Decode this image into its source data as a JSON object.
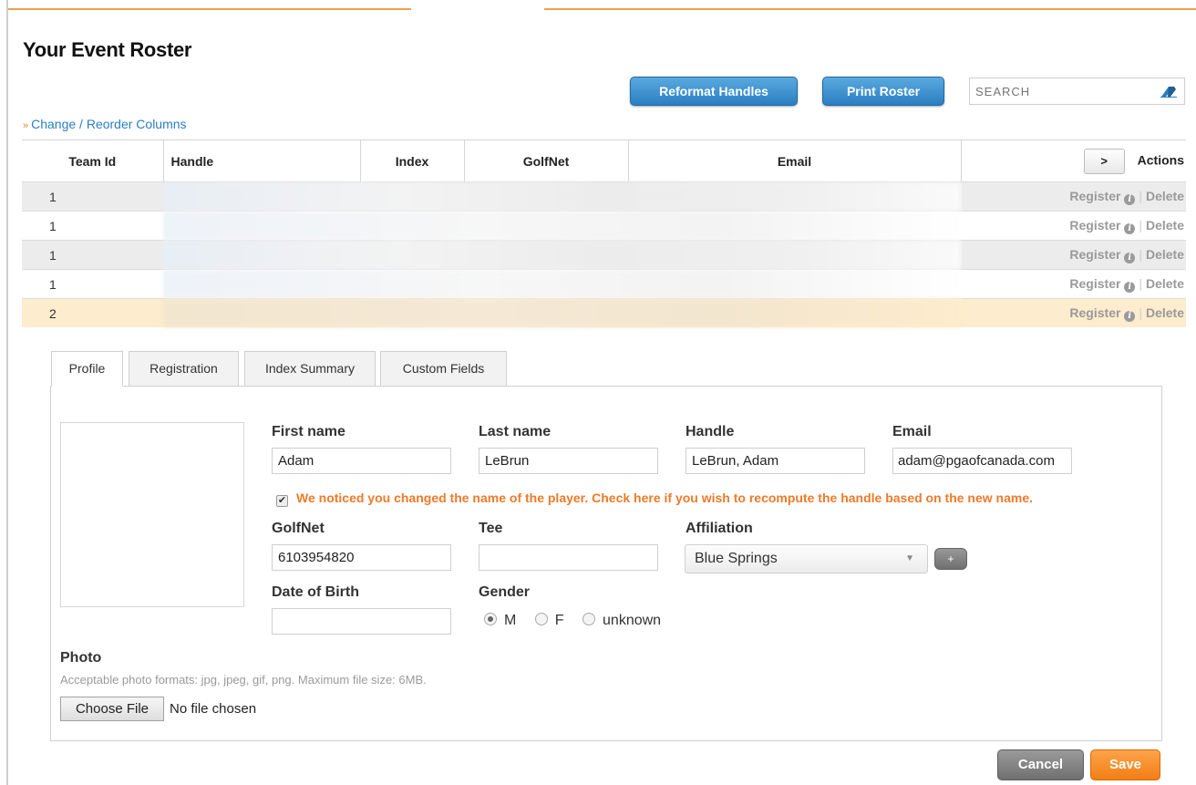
{
  "page": {
    "title": "Your Event Roster"
  },
  "toolbar": {
    "reformat_label": "Reformat Handles",
    "print_label": "Print Roster",
    "search_placeholder": "SEARCH",
    "reorder_label": "Change / Reorder Columns"
  },
  "table": {
    "headers": [
      "Team Id",
      "Handle",
      "Index",
      "GolfNet",
      "Email",
      "Actions"
    ],
    "next_label": ">",
    "register_label": "Register",
    "delete_label": "Delete",
    "rows": [
      {
        "team_id": "1"
      },
      {
        "team_id": "1"
      },
      {
        "team_id": "1"
      },
      {
        "team_id": "1"
      },
      {
        "team_id": "2",
        "selected": true
      }
    ]
  },
  "tabs": [
    "Profile",
    "Registration",
    "Index Summary",
    "Custom Fields"
  ],
  "profile": {
    "first_name_label": "First name",
    "first_name": "Adam",
    "last_name_label": "Last name",
    "last_name": "LeBrun",
    "handle_label": "Handle",
    "handle": "LeBrun, Adam",
    "email_label": "Email",
    "email": "adam@pgaofcanada.com",
    "notice": "We noticed you changed the name of the player. Check here if you wish to recompute the handle based on the new name.",
    "golfnet_label": "GolfNet",
    "golfnet": "6103954820",
    "tee_label": "Tee",
    "tee": "",
    "affiliation_label": "Affiliation",
    "affiliation": "Blue Springs",
    "add_label": "+",
    "dob_label": "Date of Birth",
    "dob": "",
    "gender_label": "Gender",
    "gender_options": [
      "M",
      "F",
      "unknown"
    ],
    "gender_selected": "M",
    "photo_label": "Photo",
    "photo_help": "Acceptable photo formats: jpg, jpeg, gif, png. Maximum file size: 6MB.",
    "choose_file_label": "Choose File",
    "no_file_label": "No file chosen"
  },
  "footer": {
    "cancel_label": "Cancel",
    "save_label": "Save"
  },
  "colors": {
    "accent_orange": "#f27e16",
    "primary_blue": "#2a7fc2",
    "notice_orange": "#ee7a2a",
    "selected_row": "#fdeccd"
  }
}
